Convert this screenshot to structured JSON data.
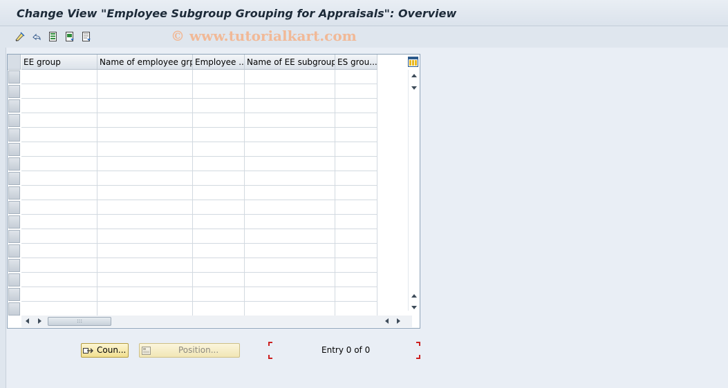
{
  "window": {
    "title": "Change View \"Employee Subgroup Grouping for Appraisals\": Overview"
  },
  "watermark": "© www.tutorialkart.com",
  "toolbar": {
    "icons": [
      "change-display-icon",
      "undo-icon",
      "select-all-icon",
      "select-block-icon",
      "deselect-all-icon"
    ]
  },
  "table": {
    "columns": [
      "EE group",
      "Name of employee grp",
      "Employee ...",
      "Name of EE subgroup",
      "ES grou..."
    ],
    "row_count": 17,
    "rows": []
  },
  "buttons": {
    "count_label": "Coun...",
    "position_label": "Position..."
  },
  "status": {
    "entry_text": "Entry 0 of 0"
  },
  "colors": {
    "title": "#1c2a38",
    "button_bg": "#f1df8f",
    "watermark": "#f1b997",
    "focus_corner": "#cc2020"
  }
}
